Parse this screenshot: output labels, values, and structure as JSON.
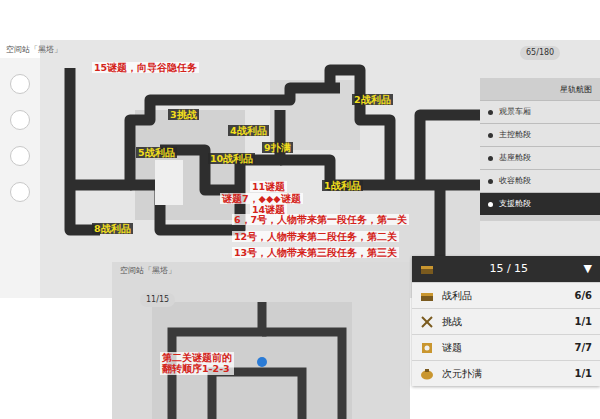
{
  "map": {
    "title": "空间站「黑塔」",
    "counter": "65/180"
  },
  "nav": {
    "title": "星轨航图",
    "items": [
      {
        "label": "观景车厢",
        "selected": false
      },
      {
        "label": "主控舱段",
        "selected": false
      },
      {
        "label": "基座舱段",
        "selected": false
      },
      {
        "label": "收容舱段",
        "selected": false
      },
      {
        "label": "支援舱段",
        "selected": true
      }
    ]
  },
  "annotations": [
    {
      "text": "15谜题，向导谷隐任务",
      "color": "#d4231a"
    },
    {
      "text": "2战利品",
      "color": "#f2df1c"
    },
    {
      "text": "3挑战",
      "color": "#f2df1c"
    },
    {
      "text": "4战利品",
      "color": "#f2df1c"
    },
    {
      "text": "9扑满",
      "color": "#f2df1c"
    },
    {
      "text": "5战利品",
      "color": "#f2df1c"
    },
    {
      "text": "10战利品",
      "color": "#f2df1c"
    },
    {
      "text": "1战利品",
      "color": "#f2df1c"
    },
    {
      "text": "11谜题",
      "color": "#d4231a"
    },
    {
      "text": "谜题7，◆◆◆谜题",
      "color": "#d4231a"
    },
    {
      "text": "14谜题",
      "color": "#d4231a"
    },
    {
      "text": "6，7号，人物带来第一段任务，第一关",
      "color": "#d4231a"
    },
    {
      "text": "12号，人物带来第二段任务，第二关",
      "color": "#d4231a"
    },
    {
      "text": "13号，人物带来第三段任务，第三关",
      "color": "#d4231a"
    },
    {
      "text": "8战利品",
      "color": "#f2df1c"
    }
  ],
  "lower_map": {
    "title": "空间站「黑塔」",
    "counter": "11/15",
    "note": [
      "第二关谜题前的",
      "翻转顺序1-2-3"
    ],
    "note_color": "#d4231a"
  },
  "summary": {
    "total": "15 / 15",
    "caret": "▼",
    "rows": [
      {
        "label": "战利品",
        "count": "6/6"
      },
      {
        "label": "挑战",
        "count": "1/1"
      },
      {
        "label": "谜题",
        "count": "7/7"
      },
      {
        "label": "次元扑满",
        "count": "1/1"
      }
    ]
  }
}
